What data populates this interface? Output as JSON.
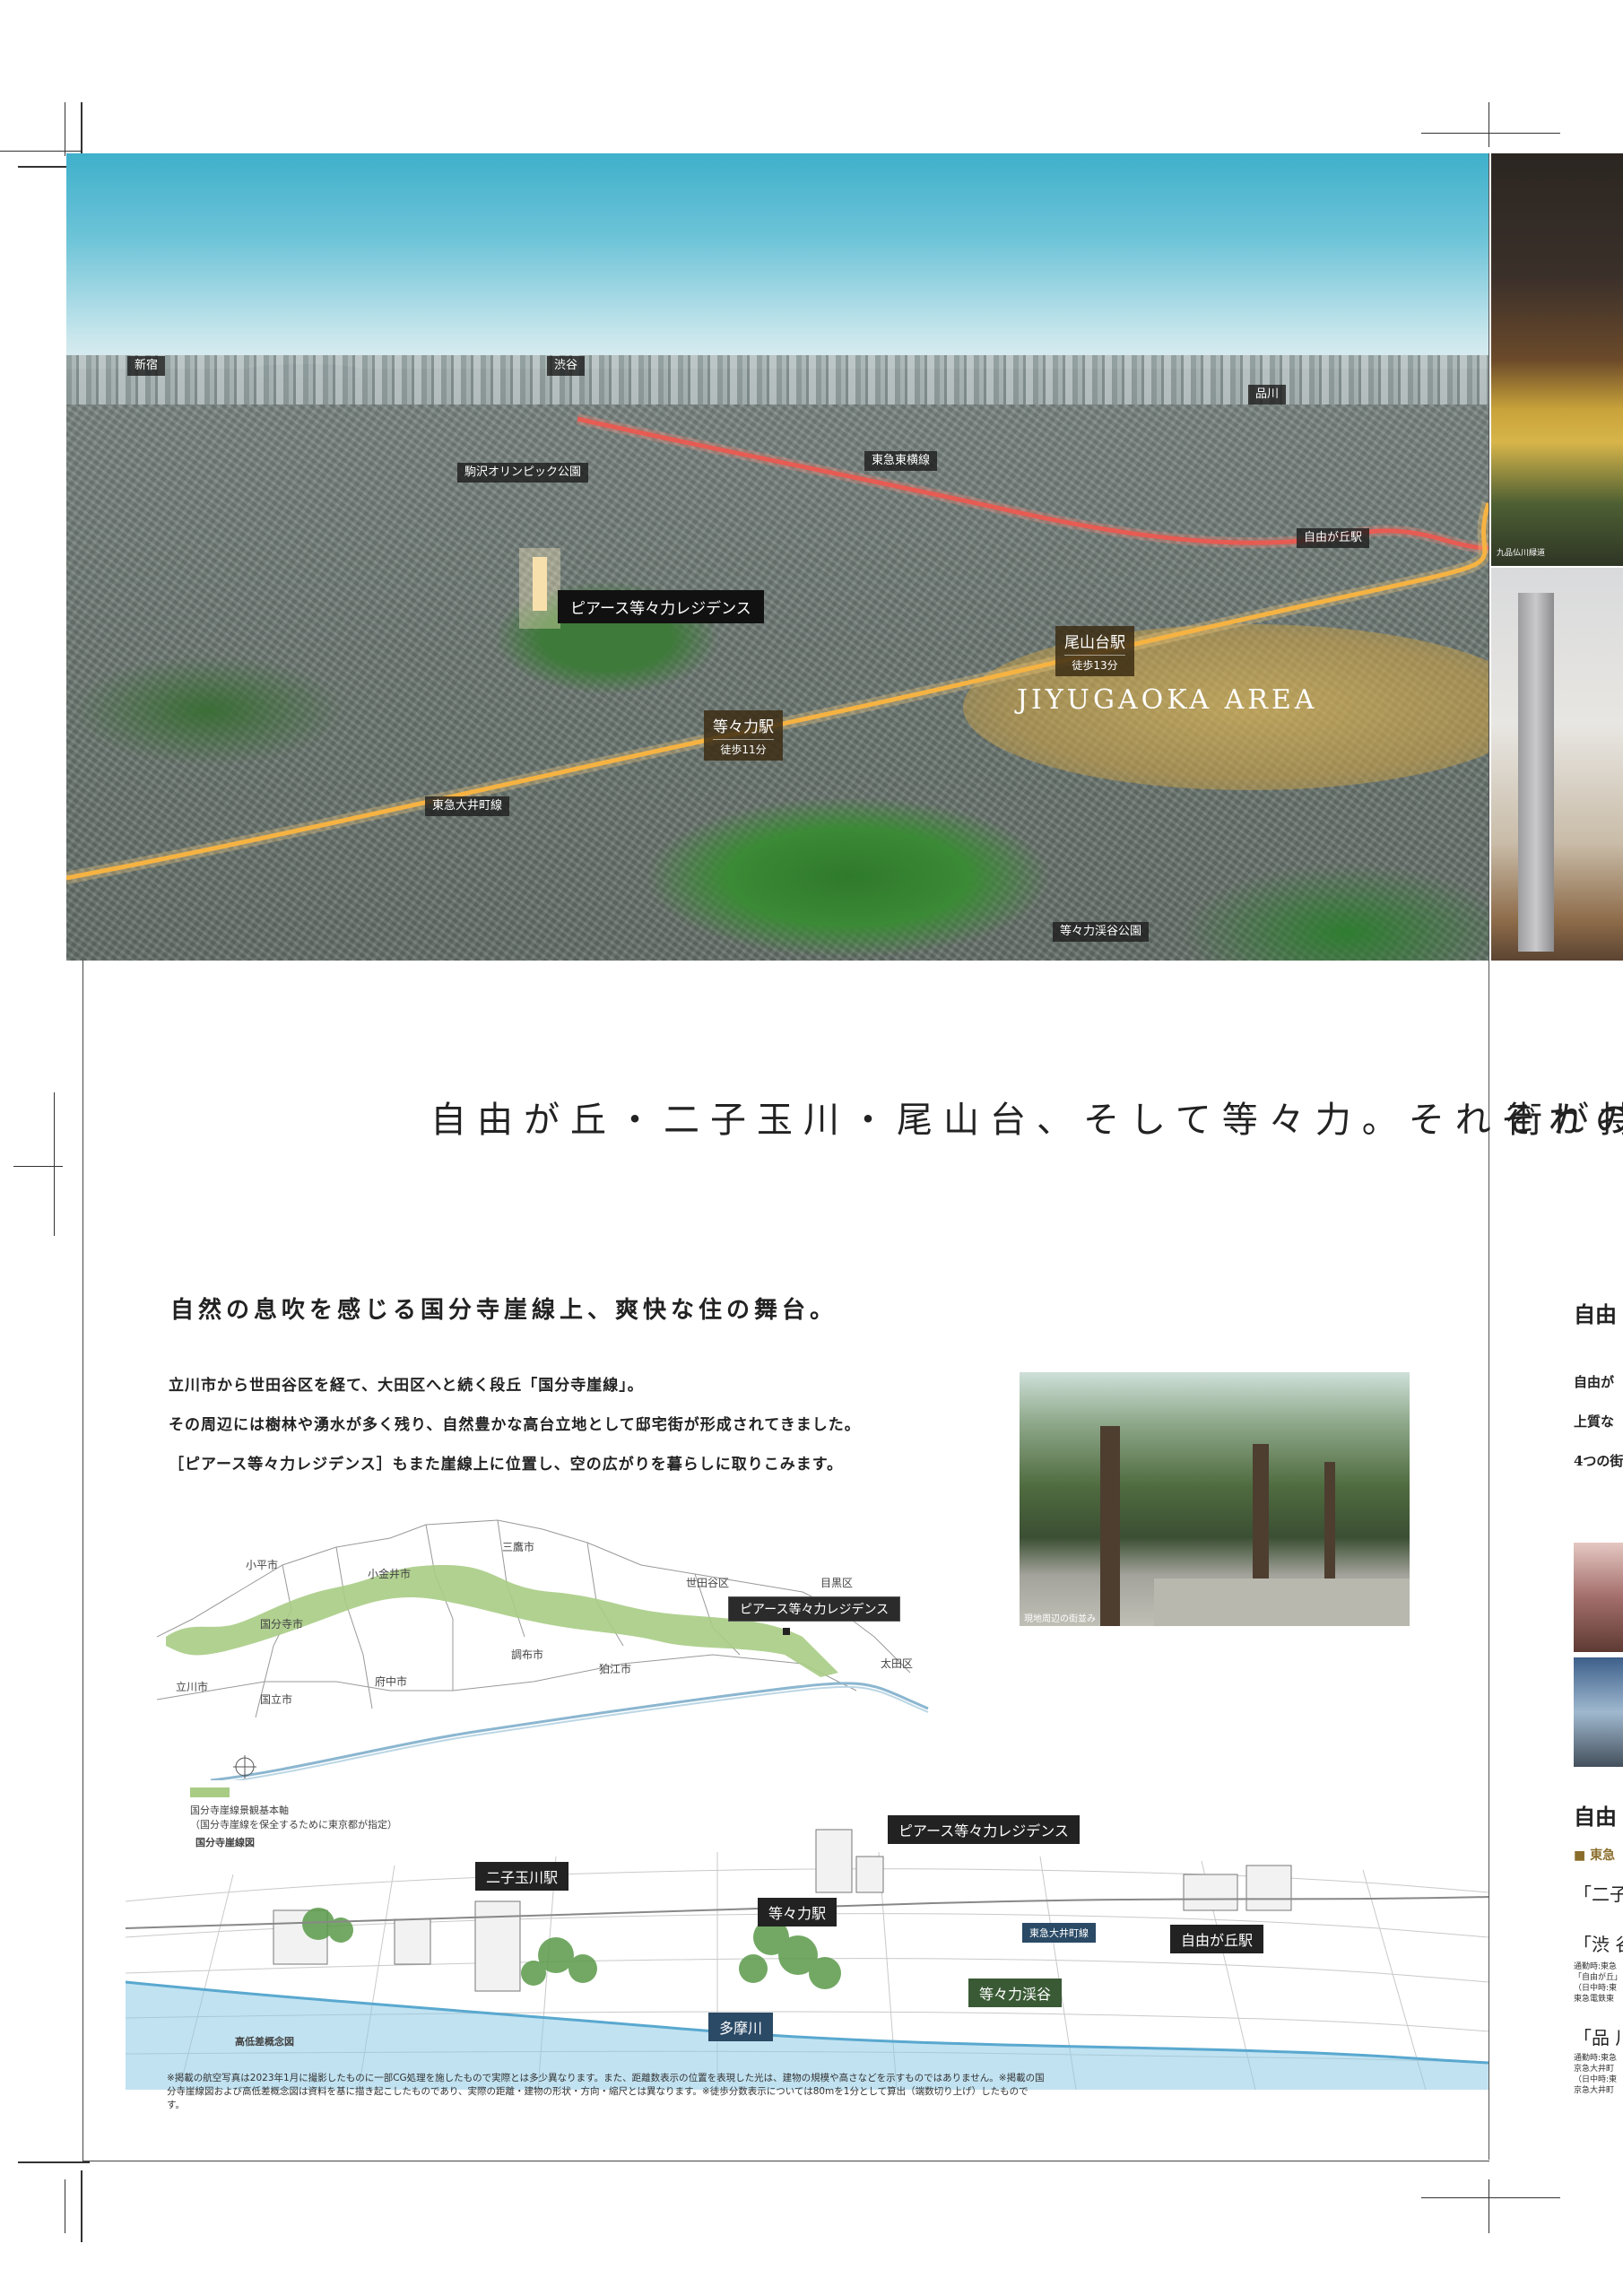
{
  "aerial": {
    "labels": {
      "shinjuku": "新宿",
      "shibuya": "渋谷",
      "shinagawa": "品川",
      "komazawa": "駒沢オリンピック公園",
      "toyoko": "東急東横線",
      "jiyugaoka_area": "JIYUGAOKA AREA",
      "jiyugaoka_station": "自由が丘駅",
      "property": "ピアース等々力レジデンス",
      "oyamadai_station": "尾山台駅",
      "oyamadai_walk": "徒歩13分",
      "todoroki_station": "等々力駅",
      "todoroki_walk": "徒歩11分",
      "oimachi": "東急大井町線",
      "todoroki_park": "等々力渓谷公園"
    },
    "line_colors": {
      "toyoko": "#e8413c",
      "oimachi": "#f3a62a"
    }
  },
  "right_photo_caption": "九品仏川緑道",
  "heading": "自由が丘・二子玉川・尾山台、そして等々力。それぞれの",
  "heading_right": "街が持",
  "section": {
    "title": "自然の息吹を感じる国分寺崖線上、爽快な住の舞台。",
    "lines": [
      "立川市から世田谷区を経て、大田区へと続く段丘「国分寺崖線」。",
      "その周辺には樹林や湧水が多く残り、自然豊かな高台立地として邸宅街が形成されてきました。",
      "［ピアース等々力レジデンス］もまた崖線上に位置し、空の広がりを暮らしに取りこみます。"
    ],
    "photo_caption": "現地周辺の街並み"
  },
  "map": {
    "cities": {
      "kodaira": "小平市",
      "koganei": "小金井市",
      "mitaka": "三鷹市",
      "setagaya": "世田谷区",
      "meguro": "目黒区",
      "kokubunji": "国分寺市",
      "chofu": "調布市",
      "komae": "狛江市",
      "ota": "太田区",
      "tachikawa": "立川市",
      "kunitachi": "国立市",
      "fuchu": "府中市"
    },
    "property_label": "ピアース等々力レジデンス",
    "legend_line1": "国分寺崖線景観基本軸",
    "legend_line2": "（国分寺崖線を保全するために東京都が指定）",
    "caption": "国分寺崖線図"
  },
  "relief": {
    "property": "ピアース等々力レジデンス",
    "futako": "二子玉川駅",
    "todoroki": "等々力駅",
    "oimachi": "東急大井町線",
    "jiyugaoka": "自由が丘駅",
    "keikoku": "等々力渓谷",
    "tamagawa": "多摩川",
    "caption": "高低差概念図"
  },
  "note": "※掲載の航空写真は2023年1月に撮影したものに一部CG処理を施したもので実際とは多少異なります。また、距離数表示の位置を表現した光は、建物の規模や高さなどを示すものではありません。※掲載の国分寺崖線図および高低差概念図は資料を基に描き起こしたものであり、実際の距離・建物の形状・方向・縮尺とは異なります。※徒歩分数表示については80mを1分として算出（端数切り上げ）したものです。",
  "right_col": {
    "title": "自由",
    "lines": [
      "自由が",
      "上質な",
      "4つの街"
    ],
    "title2": "自由",
    "sub": "■ 東急",
    "item1": "「二子",
    "item2": "「渋 谷",
    "item2_small": [
      "通勤時:東急",
      "「自由が丘」",
      "（日中時:東",
      "東急電鉄東"
    ],
    "item3": "「品 川",
    "item3_small": [
      "通勤時:東急",
      "京急大井町",
      "（日中時:東",
      "京急大井町"
    ]
  }
}
